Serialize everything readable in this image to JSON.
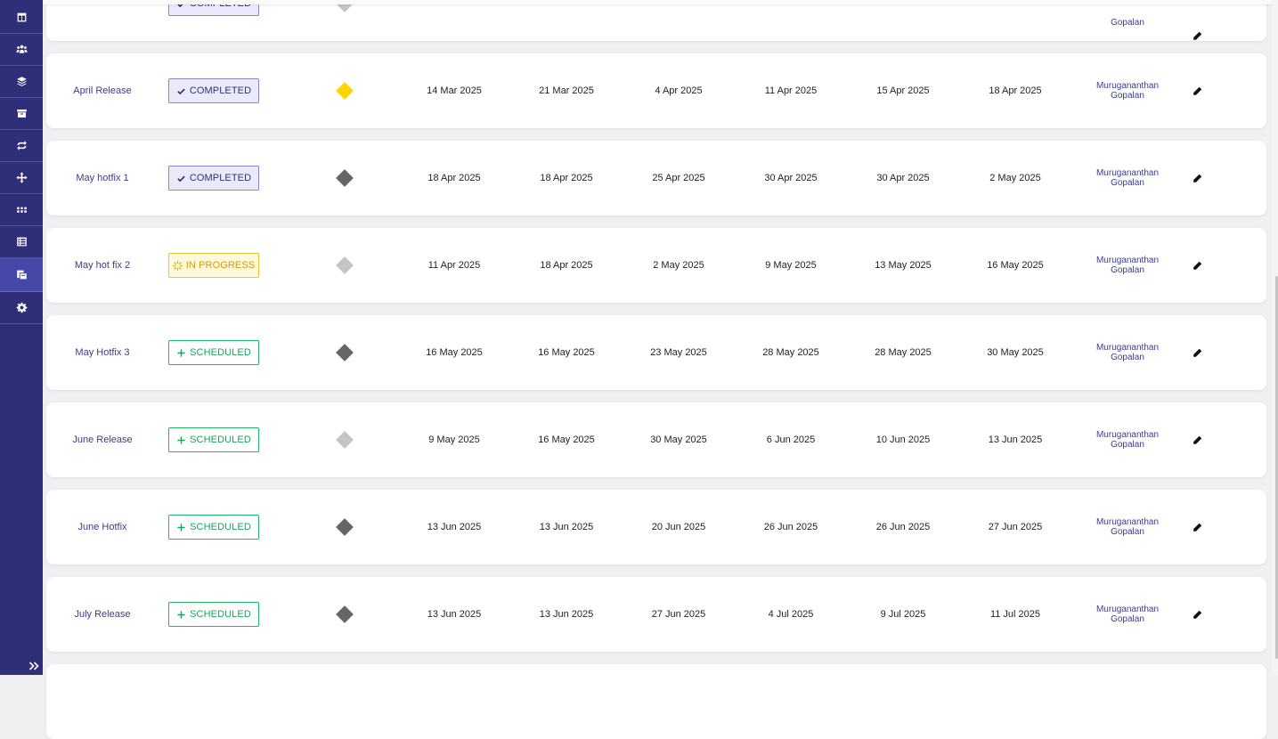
{
  "sidebar": {
    "items": [
      {
        "icon": "board-icon"
      },
      {
        "icon": "users-icon"
      },
      {
        "icon": "layers-icon"
      },
      {
        "icon": "archive-icon"
      },
      {
        "icon": "sync-icon"
      },
      {
        "icon": "move-icon"
      },
      {
        "icon": "grid-dots-icon"
      },
      {
        "icon": "list-table-icon"
      },
      {
        "icon": "releases-icon",
        "active": true
      },
      {
        "icon": "gear-icon"
      }
    ],
    "expand_icon": "double-chevron-right-icon"
  },
  "colors": {
    "sidebar_bg": "#2e2f78",
    "active_item": "#4747a8",
    "link": "#3b3c8c",
    "completed": "#2e2f78",
    "in_progress": "#d49a00",
    "scheduled": "#16a85a",
    "diamond_yellow": "#ffd500",
    "diamond_dark": "#666666",
    "diamond_light": "#c4c4c4"
  },
  "releases": [
    {
      "name": "April Release",
      "status": "COMPLETED",
      "status_type": "completed",
      "diamond": "yellow",
      "dates": [
        "14 Mar 2025",
        "21 Mar 2025",
        "4 Apr 2025",
        "11 Apr 2025",
        "15 Apr 2025",
        "18 Apr 2025"
      ],
      "owner_first": "Muruganan­than",
      "owner_last": "Gopalan"
    },
    {
      "name": "May hotfix 1",
      "status": "COMPLETED",
      "status_type": "completed",
      "diamond": "dark",
      "dates": [
        "18 Apr 2025",
        "18 Apr 2025",
        "25 Apr 2025",
        "30 Apr 2025",
        "30 Apr 2025",
        "2 May 2025"
      ],
      "owner_first": "Muruganan­than",
      "owner_last": "Gopalan"
    },
    {
      "name": "May hot fix 2",
      "status": "IN PROGRESS",
      "status_type": "inprogress",
      "diamond": "light",
      "dates": [
        "11 Apr 2025",
        "18 Apr 2025",
        "2 May 2025",
        "9 May 2025",
        "13 May 2025",
        "16 May 2025"
      ],
      "owner_first": "Muruganan­than",
      "owner_last": "Gopalan"
    },
    {
      "name": "May Hotfix 3",
      "status": "SCHEDULED",
      "status_type": "scheduled",
      "diamond": "dark",
      "dates": [
        "16 May 2025",
        "16 May 2025",
        "23 May 2025",
        "28 May 2025",
        "28 May 2025",
        "30 May 2025"
      ],
      "owner_first": "Muruganan­than",
      "owner_last": "Gopalan"
    },
    {
      "name": "June Release",
      "status": "SCHEDULED",
      "status_type": "scheduled",
      "diamond": "light",
      "dates": [
        "9 May 2025",
        "16 May 2025",
        "30 May 2025",
        "6 Jun 2025",
        "10 Jun 2025",
        "13 Jun 2025"
      ],
      "owner_first": "Muruganan­than",
      "owner_last": "Gopalan"
    },
    {
      "name": "June Hotfix",
      "status": "SCHEDULED",
      "status_type": "scheduled",
      "diamond": "dark",
      "dates": [
        "13 Jun 2025",
        "13 Jun 2025",
        "20 Jun 2025",
        "26 Jun 2025",
        "26 Jun 2025",
        "27 Jun 2025"
      ],
      "owner_first": "Muruganan­than",
      "owner_last": "Gopalan"
    },
    {
      "name": "July Release",
      "status": "SCHEDULED",
      "status_type": "scheduled",
      "diamond": "dark",
      "dates": [
        "13 Jun 2025",
        "13 Jun 2025",
        "27 Jun 2025",
        "4 Jul 2025",
        "9 Jul 2025",
        "11 Jul 2025"
      ],
      "owner_first": "Muruganan­than",
      "owner_last": "Gopalan"
    }
  ],
  "partial_top_row": {
    "status": "COMPLETED",
    "diamond": "light",
    "owner_last": "Gopalan"
  }
}
